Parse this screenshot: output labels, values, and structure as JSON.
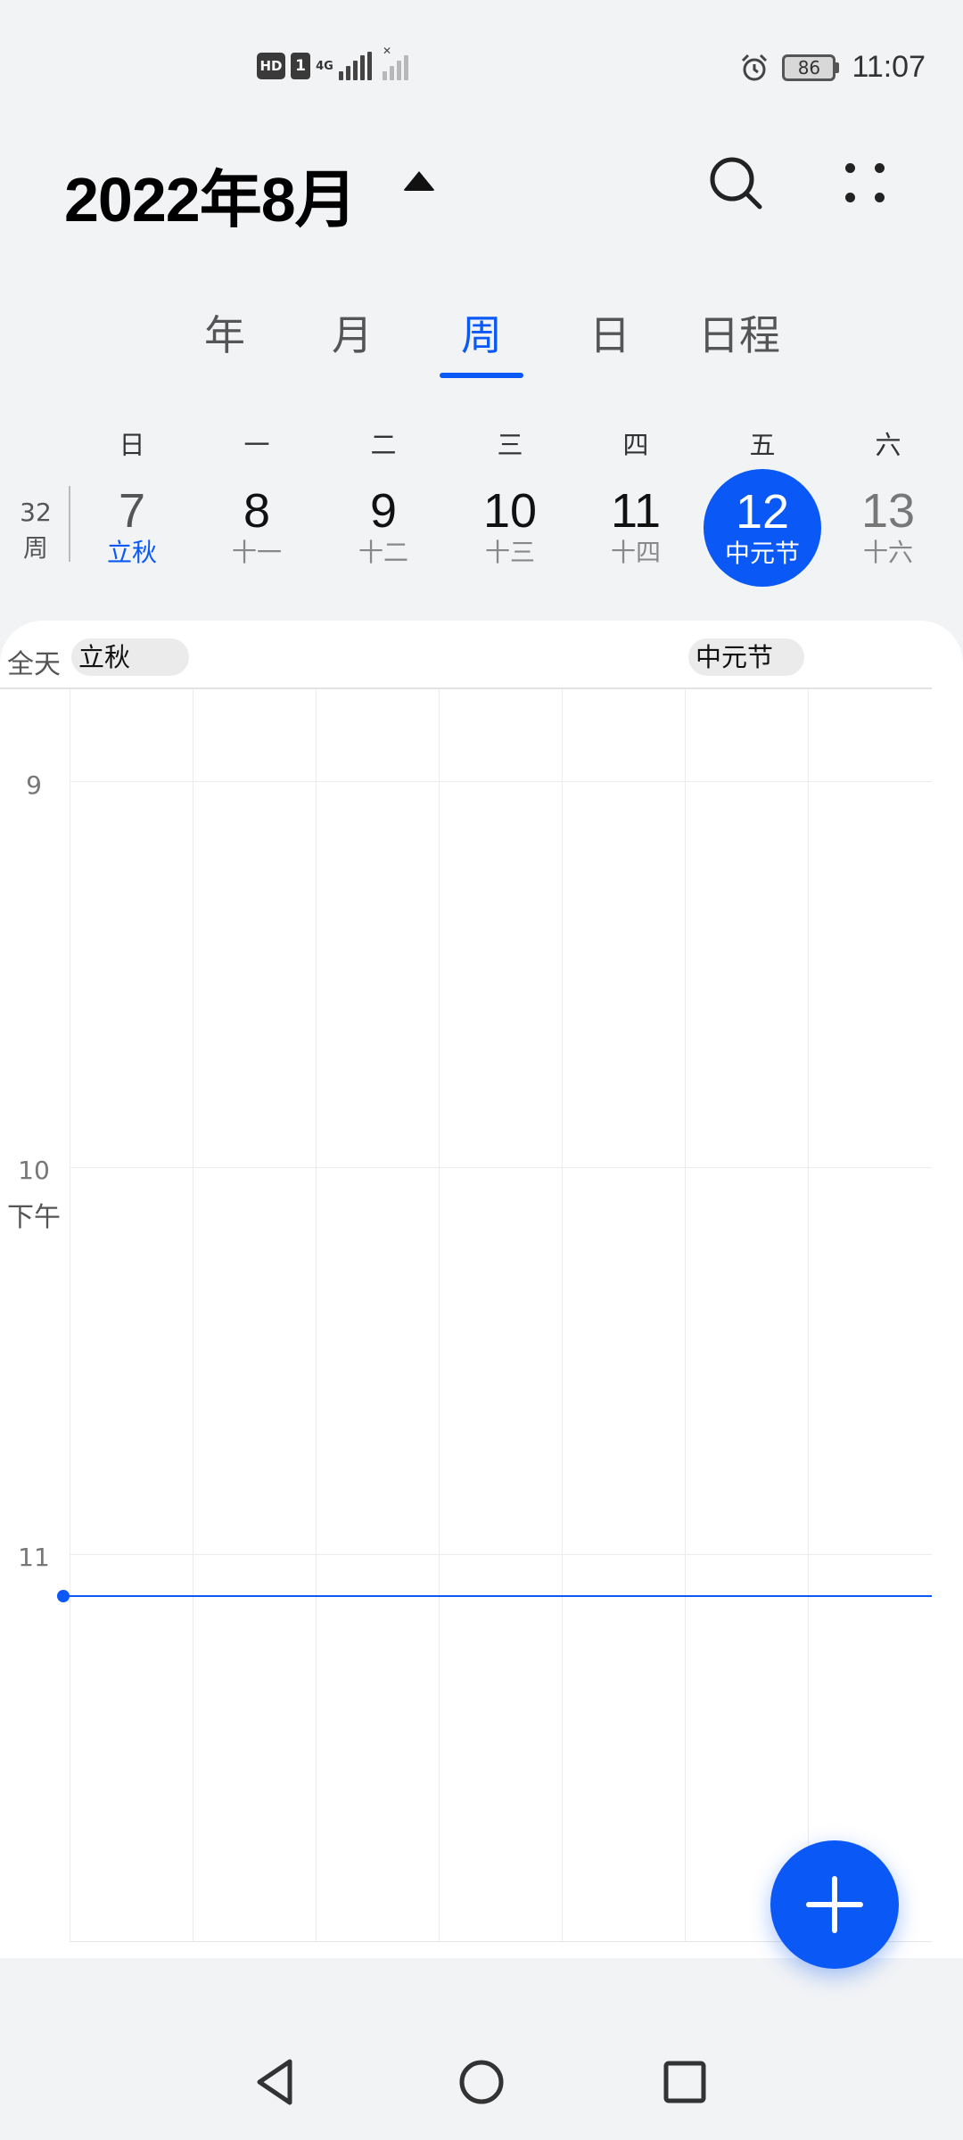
{
  "status_bar": {
    "hd": "HD",
    "sim": "1",
    "network": "4G",
    "battery": "86",
    "time": "11:07"
  },
  "header": {
    "title": "2022年8月"
  },
  "tabs": [
    {
      "label": "年",
      "active": false
    },
    {
      "label": "月",
      "active": false
    },
    {
      "label": "周",
      "active": true
    },
    {
      "label": "日",
      "active": false
    },
    {
      "label": "日程",
      "active": false
    }
  ],
  "week": {
    "number": "32",
    "unit": "周",
    "weekdays": [
      "日",
      "一",
      "二",
      "三",
      "四",
      "五",
      "六"
    ],
    "days": [
      {
        "num": "7",
        "lunar": "立秋"
      },
      {
        "num": "8",
        "lunar": "十一"
      },
      {
        "num": "9",
        "lunar": "十二"
      },
      {
        "num": "10",
        "lunar": "十三"
      },
      {
        "num": "11",
        "lunar": "十四"
      },
      {
        "num": "12",
        "lunar": "中元节",
        "today": true
      },
      {
        "num": "13",
        "lunar": "十六"
      }
    ]
  },
  "all_day": {
    "label": "全天",
    "events": [
      {
        "title": "立秋",
        "day_index": 0
      },
      {
        "title": "中元节",
        "day_index": 5
      }
    ]
  },
  "hours": [
    {
      "label": "9"
    },
    {
      "label": "10",
      "period": "下午"
    },
    {
      "label": "11"
    }
  ],
  "colors": {
    "accent": "#0a59f7",
    "background": "#f1f3f5"
  }
}
